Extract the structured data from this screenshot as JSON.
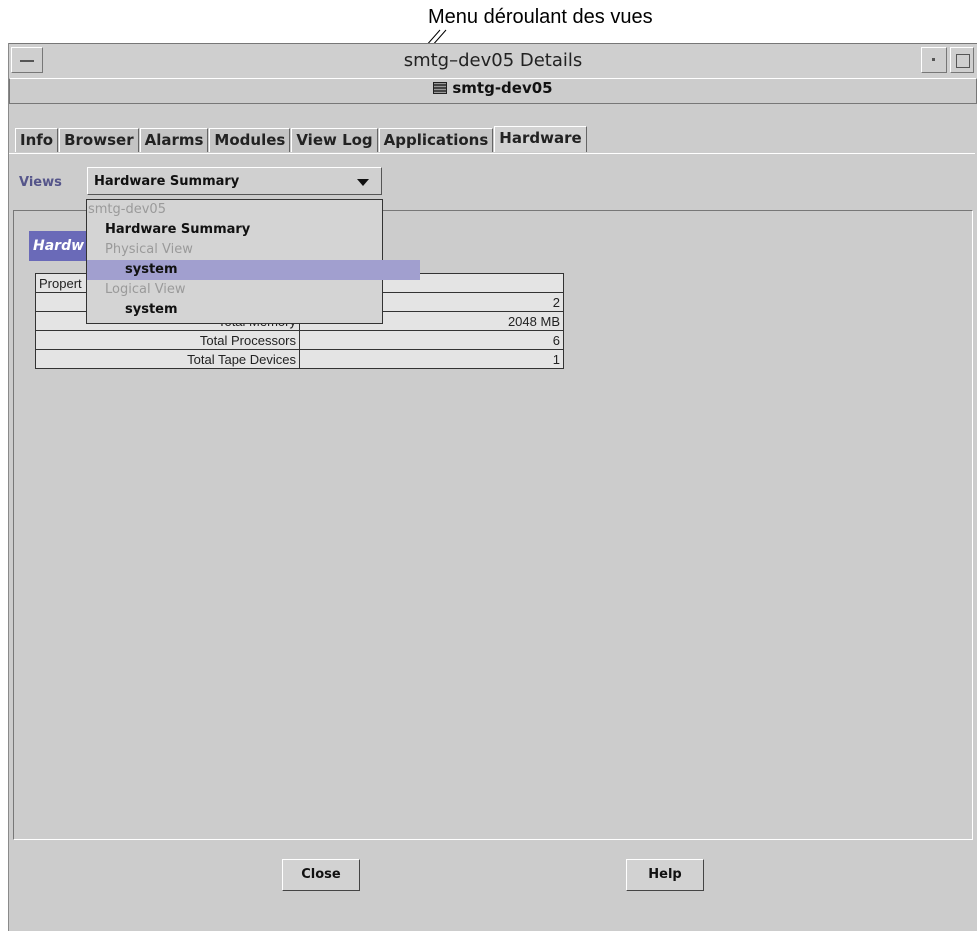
{
  "annotation": {
    "text": "Menu déroulant des vues"
  },
  "window": {
    "title": "smtg–dev05 Details",
    "host": {
      "icon": "server-icon",
      "name": "smtg-dev05"
    }
  },
  "tabs": [
    {
      "label": "Info"
    },
    {
      "label": "Browser"
    },
    {
      "label": "Alarms"
    },
    {
      "label": "Modules"
    },
    {
      "label": "View Log"
    },
    {
      "label": "Applications"
    },
    {
      "label": "Hardware",
      "active": true
    }
  ],
  "views": {
    "label": "Views",
    "selected": "Hardware Summary",
    "options": [
      {
        "label": "smtg-dev05",
        "enabled": false
      },
      {
        "label": "Hardware Summary",
        "enabled": true
      },
      {
        "label": "Physical View",
        "enabled": false
      },
      {
        "label": "system",
        "enabled": true,
        "highlighted": true
      },
      {
        "label": "Logical View",
        "enabled": false
      },
      {
        "label": "system",
        "enabled": true
      }
    ]
  },
  "section": {
    "title": "Hardw"
  },
  "table": {
    "header": [
      "Propert",
      ""
    ],
    "rows": [
      {
        "property": "",
        "value": "2"
      },
      {
        "property": "Total Memory",
        "value": "2048 MB"
      },
      {
        "property": "Total Processors",
        "value": "6"
      },
      {
        "property": "Total Tape Devices",
        "value": "1"
      }
    ]
  },
  "buttons": {
    "close": "Close",
    "help": "Help"
  }
}
